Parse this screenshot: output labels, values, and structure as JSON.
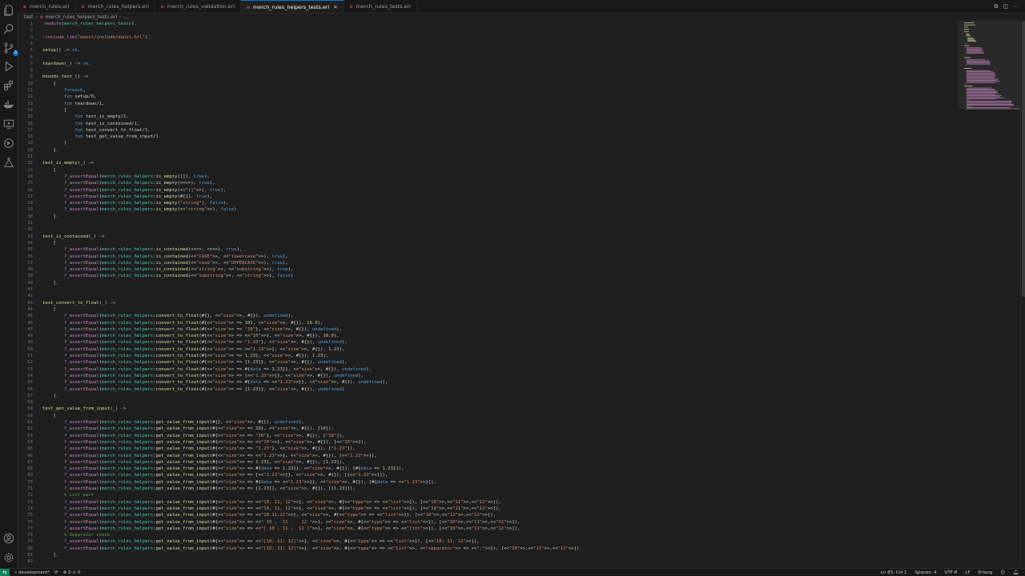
{
  "tabs": [
    {
      "label": "merch_rules.erl",
      "active": false
    },
    {
      "label": "merch_rules_helpers.erl",
      "active": false
    },
    {
      "label": "merch_rules_validation.erl",
      "active": false
    },
    {
      "label": "merch_rules_helpers_tests.erl",
      "active": true
    },
    {
      "label": "merch_rules_tests.erl",
      "active": false
    }
  ],
  "breadcrumb": {
    "folder": "test",
    "file": "merch_rules_helpers_tests.erl",
    "more": "..."
  },
  "colors": {
    "accent": "#0078d4",
    "keyword": "#c586c0",
    "function": "#dcdcaa",
    "module": "#4ec9b0",
    "string": "#ce9178",
    "atom": "#569cd6",
    "comment": "#6a9955",
    "number": "#b5cea8",
    "default": "#d4d4d4",
    "erlang_icon": "#e05a4f"
  },
  "activity_icons": [
    "files-icon",
    "search-icon",
    "source-control-icon",
    "run-debug-icon",
    "extensions-icon",
    "docker-icon",
    "remote-explorer-icon",
    "timeline-icon",
    "testing-icon",
    "account-icon",
    "settings-gear-icon"
  ],
  "source_control_badge": "3",
  "editor": {
    "lines": [
      {
        "n": "1",
        "text": "-module(merch_rules_helpers_tests)."
      },
      {
        "n": "2",
        "text": ""
      },
      {
        "n": "3",
        "text": "-include_lib(\"eunit/include/eunit.hrl\")."
      },
      {
        "n": "4",
        "text": ""
      },
      {
        "n": "5",
        "text": "setup() -> ok."
      },
      {
        "n": "6",
        "text": ""
      },
      {
        "n": "7",
        "text": "teardown(_) -> ok."
      },
      {
        "n": "8",
        "text": ""
      },
      {
        "n": "9",
        "text": "bounds_test_() ->"
      },
      {
        "n": "10",
        "text": "    {"
      },
      {
        "n": "11",
        "text": "        foreach,"
      },
      {
        "n": "12",
        "text": "        fun setup/0,"
      },
      {
        "n": "13",
        "text": "        fun teardown/1,"
      },
      {
        "n": "14",
        "text": "        ["
      },
      {
        "n": "15",
        "text": "            fun test_is_empty/1,"
      },
      {
        "n": "16",
        "text": "            fun test_is_contained/1,"
      },
      {
        "n": "17",
        "text": "            fun test_convert_to_float/1,"
      },
      {
        "n": "18",
        "text": "            fun test_get_value_from_input/1"
      },
      {
        "n": "19",
        "text": "        ]"
      },
      {
        "n": "20",
        "text": "    }."
      },
      {
        "n": "21",
        "text": ""
      },
      {
        "n": "22",
        "text": "test_is_empty(_) ->"
      },
      {
        "n": "23",
        "text": "    ["
      },
      {
        "n": "24",
        "text": "        ?_assertEqual(merch_rules_helpers:is_empty([]), true),"
      },
      {
        "n": "25",
        "text": "        ?_assertEqual(merch_rules_helpers:is_empty(<<>>), true),"
      },
      {
        "n": "26",
        "text": "        ?_assertEqual(merch_rules_helpers:is_empty(<<\"[]\">>), true),"
      },
      {
        "n": "27",
        "text": "        ?_assertEqual(merch_rules_helpers:is_empty(#{}), true),"
      },
      {
        "n": "28",
        "text": "        ?_assertEqual(merch_rules_helpers:is_empty(\"string\"), false),"
      },
      {
        "n": "29",
        "text": "        ?_assertEqual(merch_rules_helpers:is_empty(<<\"string\">>), false)"
      },
      {
        "n": "30",
        "text": "    ]."
      },
      {
        "n": "31",
        "text": ""
      },
      {
        "n": "32",
        "text": ""
      },
      {
        "n": "33",
        "text": "test_is_contained(_) ->"
      },
      {
        "n": "34",
        "text": "    ["
      },
      {
        "n": "35",
        "text": "        ?_assertEqual(merch_rules_helpers:is_contained(<<>>, <<>>), true),"
      },
      {
        "n": "36",
        "text": "        ?_assertEqual(merch_rules_helpers:is_contained(<<\"CASE\">>, <<\"lowercase\">>), true),"
      },
      {
        "n": "37",
        "text": "        ?_assertEqual(merch_rules_helpers:is_contained(<<\"case\">>, <<\"UPPERCASE\">>), true),"
      },
      {
        "n": "38",
        "text": "        ?_assertEqual(merch_rules_helpers:is_contained(<<\"string\">>, <<\"substring\">>), true),"
      },
      {
        "n": "39",
        "text": "        ?_assertEqual(merch_rules_helpers:is_contained(<<\"substring\">>, <<\"string\">>), false)"
      },
      {
        "n": "40",
        "text": "    ]."
      },
      {
        "n": "41",
        "text": ""
      },
      {
        "n": "42",
        "text": ""
      },
      {
        "n": "43",
        "text": "test_convert_to_float(_) ->"
      },
      {
        "n": "44",
        "text": "    ["
      },
      {
        "n": "45",
        "text": "        ?_assertEqual(merch_rules_helpers:convert_to_float(#{}, <<\"size\">>, #{}), undefined),"
      },
      {
        "n": "46",
        "text": "        ?_assertEqual(merch_rules_helpers:convert_to_float(#{<<\"size\">> => 10}, <<\"size\">>, #{}), 10.0),"
      },
      {
        "n": "47",
        "text": "        ?_assertEqual(merch_rules_helpers:convert_to_float(#{<<\"size\">> => \"10\"}, <<\"size\">>, #{}), undefined),"
      },
      {
        "n": "48",
        "text": "        ?_assertEqual(merch_rules_helpers:convert_to_float(#{<<\"size\">> => <<\"10\">>}, <<\"size\">>, #{}), 10.0),"
      },
      {
        "n": "49",
        "text": "        ?_assertEqual(merch_rules_helpers:convert_to_float(#{<<\"size\">> => \"1.23\"}, <<\"size\">>, #{}), undefined),"
      },
      {
        "n": "50",
        "text": "        ?_assertEqual(merch_rules_helpers:convert_to_float(#{<<\"size\">> => <<\"1.23\">>}, <<\"size\">>, #{}), 1.23),"
      },
      {
        "n": "51",
        "text": "        ?_assertEqual(merch_rules_helpers:convert_to_float(#{<<\"size\">> => 1.23}, <<\"size\">>, #{}), 1.23),"
      },
      {
        "n": "52",
        "text": "        ?_assertEqual(merch_rules_helpers:convert_to_float(#{<<\"size\">> => [1.23]}, <<\"size\">>, #{}), undefined),"
      },
      {
        "n": "53",
        "text": "        ?_assertEqual(merch_rules_helpers:convert_to_float(#{<<\"size\">> => #{data => 1.23}}, <<\"size\">>, #{}), undefined),"
      },
      {
        "n": "54",
        "text": "        ?_assertEqual(merch_rules_helpers:convert_to_float(#{<<\"size\">> => [<<\"1.23\">>]}, <<\"size\">>, #{}), undefined),"
      },
      {
        "n": "55",
        "text": "        ?_assertEqual(merch_rules_helpers:convert_to_float(#{<<\"size\">> => #{data => <<\"1.23\">>}}, <<\"size\">>, #{}), undefined),"
      },
      {
        "n": "56",
        "text": "        ?_assertEqual(merch_rules_helpers:convert_to_float(#{<<\"size\">> => [1.23]}, <<\"size\">>, #{}), undefined)"
      },
      {
        "n": "57",
        "text": "    ]."
      },
      {
        "n": "58",
        "text": ""
      },
      {
        "n": "59",
        "text": "test_get_value_from_input(_) ->"
      },
      {
        "n": "60",
        "text": "    ["
      },
      {
        "n": "61",
        "text": "        ?_assertEqual(merch_rules_helpers:get_value_from_input(#{}, <<\"size\">>, #{}), undefined),"
      },
      {
        "n": "62",
        "text": "        ?_assertEqual(merch_rules_helpers:get_value_from_input(#{<<\"size\">> => 10}, <<\"size\">>, #{}), [10]),"
      },
      {
        "n": "63",
        "text": "        ?_assertEqual(merch_rules_helpers:get_value_from_input(#{<<\"size\">> => \"10\"}, <<\"size\">>, #{}), [\"10\"]),"
      },
      {
        "n": "64",
        "text": "        ?_assertEqual(merch_rules_helpers:get_value_from_input(#{<<\"size\">> => <<\"10\">>}, <<\"size\">>, #{}), [<<\"10\">>]),"
      },
      {
        "n": "65",
        "text": "        ?_assertEqual(merch_rules_helpers:get_value_from_input(#{<<\"size\">> => \"1.23\"}, <<\"size\">>, #{}), [\"1.23\"]),"
      },
      {
        "n": "66",
        "text": "        ?_assertEqual(merch_rules_helpers:get_value_from_input(#{<<\"size\">> => <<\"1.23\">>}, <<\"size\">>, #{}), [<<\"1.23\">>]),"
      },
      {
        "n": "67",
        "text": "        ?_assertEqual(merch_rules_helpers:get_value_from_input(#{<<\"size\">> => 1.23}, <<\"size\">>, #{}), [1.23]),"
      },
      {
        "n": "68",
        "text": "        ?_assertEqual(merch_rules_helpers:get_value_from_input(#{<<\"size\">> => #{data => 1.23}}, <<\"size\">>, #{}), [#{data => 1.23}]),"
      },
      {
        "n": "69",
        "text": "        ?_assertEqual(merch_rules_helpers:get_value_from_input(#{<<\"size\">> => [<<\"1.23\">>]}, <<\"size\">>, #{}), [[<<\"1.23\">>]]),"
      },
      {
        "n": "70",
        "text": "        ?_assertEqual(merch_rules_helpers:get_value_from_input(#{<<\"size\">> => #{data => <<\"1.23\">>}}, <<\"size\">>, #{}), [#{data => <<\"1.23\">>}]),"
      },
      {
        "n": "71",
        "text": "        ?_assertEqual(merch_rules_helpers:get_value_from_input(#{<<\"size\">> => [1.23]}, <<\"size\">>, #{}), [[1.23]]),"
      },
      {
        "n": "72",
        "text": "        % List part"
      },
      {
        "n": "73",
        "text": "        ?_assertEqual(merch_rules_helpers:get_value_from_input(#{<<\"size\">> => <<\"10, 11, 12\">>}, <<\"size\">>, #{<<\"type\">> => <<\"list\">>}), [<<\"10\">>,<<\"11\">>,<<\"12\">>]),"
      },
      {
        "n": "74",
        "text": "        ?_assertEqual(merch_rules_helpers:get_value_from_input(#{<<\"size\">> => <<\"10, 11, 12\">>}, <<\"size\">>, #{<<\"type\">> => <<\"list\">>}), [<<\"10\">>,<<\"11\">>,<<\"12\">>]),"
      },
      {
        "n": "75",
        "text": "        ?_assertEqual(merch_rules_helpers:get_value_from_input(#{<<\"size\">> => <<\"10,11,12\">>}, <<\"size\">>, #{<<\"type\">> => <<\"list\">>}), [<<\"10\">>,<<\"11\">>,<<\"12\">>]),"
      },
      {
        "n": "76",
        "text": "        ?_assertEqual(merch_rules_helpers:get_value_from_input(#{<<\"size\">> => <<\" 10 ,  11 ,   12 \">>}, <<\"size\">>, #{<<\"type\">> => <<\"list\">>}), [<<\"10\">>,<<\"11\">>,<<\"12\">>]),"
      },
      {
        "n": "77",
        "text": "        ?_assertEqual(merch_rules_helpers:get_value_from_input(#{<<\"size\">> => <<\"[ 10 , 11 ,  12 ]\">>}, <<\"size\">>, #{<<\"type\">> => <<\"list\">>}), [<<\"10\">>,<<\"11\">>,<<\"12\">>]),"
      },
      {
        "n": "78",
        "text": "        % Separator check"
      },
      {
        "n": "79",
        "text": "        ?_assertEqual(merch_rules_helpers:get_value_from_input(#{<<\"size\">> => <<\"[10; 11; 12]\">>}, <<\"size\">>, #{<<\"type\">> => <<\"list\">>}), [<<\"10; 11; 12\">>]),"
      },
      {
        "n": "80",
        "text": "        ?_assertEqual(merch_rules_helpers:get_value_from_input(#{<<\"size\">> => <<\"[10; 11; 12]\">>}, <<\"size\">>, #{<<\"type\">> => <<\"list\">>, <<\"separator\">> => <<\";\">>}), [<<\"10\">>,<<\"11\">>,<<\"12\">>])"
      },
      {
        "n": "81",
        "text": "    ]."
      },
      {
        "n": "82",
        "text": ""
      }
    ]
  },
  "statusbar": {
    "branch": "development*",
    "sync_icon": "sync-icon",
    "problems": "0 ⚠ 0",
    "position": "Ln 83, Col 1",
    "spaces": "Spaces: 4",
    "encoding": "UTF-8",
    "eol": "LF",
    "language": "Erlang",
    "remote_icon": "remote-icon",
    "notifications_icon": "bell-icon"
  }
}
